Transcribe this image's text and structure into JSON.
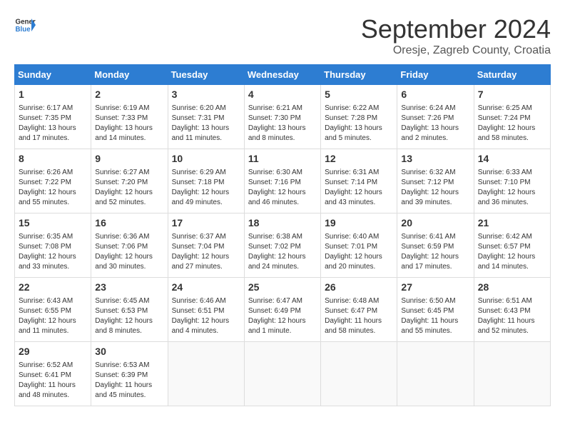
{
  "logo": {
    "general": "General",
    "blue": "Blue"
  },
  "title": "September 2024",
  "subtitle": "Oresje, Zagreb County, Croatia",
  "days_header": [
    "Sunday",
    "Monday",
    "Tuesday",
    "Wednesday",
    "Thursday",
    "Friday",
    "Saturday"
  ],
  "weeks": [
    [
      {
        "day": "1",
        "info": "Sunrise: 6:17 AM\nSunset: 7:35 PM\nDaylight: 13 hours\nand 17 minutes."
      },
      {
        "day": "2",
        "info": "Sunrise: 6:19 AM\nSunset: 7:33 PM\nDaylight: 13 hours\nand 14 minutes."
      },
      {
        "day": "3",
        "info": "Sunrise: 6:20 AM\nSunset: 7:31 PM\nDaylight: 13 hours\nand 11 minutes."
      },
      {
        "day": "4",
        "info": "Sunrise: 6:21 AM\nSunset: 7:30 PM\nDaylight: 13 hours\nand 8 minutes."
      },
      {
        "day": "5",
        "info": "Sunrise: 6:22 AM\nSunset: 7:28 PM\nDaylight: 13 hours\nand 5 minutes."
      },
      {
        "day": "6",
        "info": "Sunrise: 6:24 AM\nSunset: 7:26 PM\nDaylight: 13 hours\nand 2 minutes."
      },
      {
        "day": "7",
        "info": "Sunrise: 6:25 AM\nSunset: 7:24 PM\nDaylight: 12 hours\nand 58 minutes."
      }
    ],
    [
      {
        "day": "8",
        "info": "Sunrise: 6:26 AM\nSunset: 7:22 PM\nDaylight: 12 hours\nand 55 minutes."
      },
      {
        "day": "9",
        "info": "Sunrise: 6:27 AM\nSunset: 7:20 PM\nDaylight: 12 hours\nand 52 minutes."
      },
      {
        "day": "10",
        "info": "Sunrise: 6:29 AM\nSunset: 7:18 PM\nDaylight: 12 hours\nand 49 minutes."
      },
      {
        "day": "11",
        "info": "Sunrise: 6:30 AM\nSunset: 7:16 PM\nDaylight: 12 hours\nand 46 minutes."
      },
      {
        "day": "12",
        "info": "Sunrise: 6:31 AM\nSunset: 7:14 PM\nDaylight: 12 hours\nand 43 minutes."
      },
      {
        "day": "13",
        "info": "Sunrise: 6:32 AM\nSunset: 7:12 PM\nDaylight: 12 hours\nand 39 minutes."
      },
      {
        "day": "14",
        "info": "Sunrise: 6:33 AM\nSunset: 7:10 PM\nDaylight: 12 hours\nand 36 minutes."
      }
    ],
    [
      {
        "day": "15",
        "info": "Sunrise: 6:35 AM\nSunset: 7:08 PM\nDaylight: 12 hours\nand 33 minutes."
      },
      {
        "day": "16",
        "info": "Sunrise: 6:36 AM\nSunset: 7:06 PM\nDaylight: 12 hours\nand 30 minutes."
      },
      {
        "day": "17",
        "info": "Sunrise: 6:37 AM\nSunset: 7:04 PM\nDaylight: 12 hours\nand 27 minutes."
      },
      {
        "day": "18",
        "info": "Sunrise: 6:38 AM\nSunset: 7:02 PM\nDaylight: 12 hours\nand 24 minutes."
      },
      {
        "day": "19",
        "info": "Sunrise: 6:40 AM\nSunset: 7:01 PM\nDaylight: 12 hours\nand 20 minutes."
      },
      {
        "day": "20",
        "info": "Sunrise: 6:41 AM\nSunset: 6:59 PM\nDaylight: 12 hours\nand 17 minutes."
      },
      {
        "day": "21",
        "info": "Sunrise: 6:42 AM\nSunset: 6:57 PM\nDaylight: 12 hours\nand 14 minutes."
      }
    ],
    [
      {
        "day": "22",
        "info": "Sunrise: 6:43 AM\nSunset: 6:55 PM\nDaylight: 12 hours\nand 11 minutes."
      },
      {
        "day": "23",
        "info": "Sunrise: 6:45 AM\nSunset: 6:53 PM\nDaylight: 12 hours\nand 8 minutes."
      },
      {
        "day": "24",
        "info": "Sunrise: 6:46 AM\nSunset: 6:51 PM\nDaylight: 12 hours\nand 4 minutes."
      },
      {
        "day": "25",
        "info": "Sunrise: 6:47 AM\nSunset: 6:49 PM\nDaylight: 12 hours\nand 1 minute."
      },
      {
        "day": "26",
        "info": "Sunrise: 6:48 AM\nSunset: 6:47 PM\nDaylight: 11 hours\nand 58 minutes."
      },
      {
        "day": "27",
        "info": "Sunrise: 6:50 AM\nSunset: 6:45 PM\nDaylight: 11 hours\nand 55 minutes."
      },
      {
        "day": "28",
        "info": "Sunrise: 6:51 AM\nSunset: 6:43 PM\nDaylight: 11 hours\nand 52 minutes."
      }
    ],
    [
      {
        "day": "29",
        "info": "Sunrise: 6:52 AM\nSunset: 6:41 PM\nDaylight: 11 hours\nand 48 minutes."
      },
      {
        "day": "30",
        "info": "Sunrise: 6:53 AM\nSunset: 6:39 PM\nDaylight: 11 hours\nand 45 minutes."
      },
      {
        "day": "",
        "info": ""
      },
      {
        "day": "",
        "info": ""
      },
      {
        "day": "",
        "info": ""
      },
      {
        "day": "",
        "info": ""
      },
      {
        "day": "",
        "info": ""
      }
    ]
  ]
}
